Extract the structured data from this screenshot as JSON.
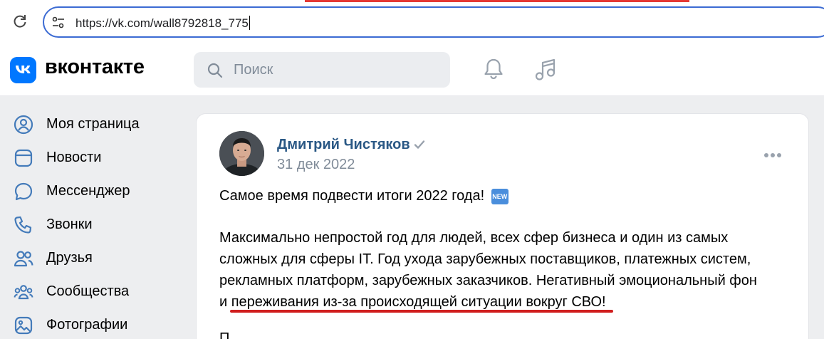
{
  "browser": {
    "url": "https://vk.com/wall8792818_775"
  },
  "header": {
    "brand": "вконтакте",
    "search_placeholder": "Поиск"
  },
  "sidebar": {
    "items": [
      {
        "label": "Моя страница",
        "icon": "user-circle-icon"
      },
      {
        "label": "Новости",
        "icon": "news-icon"
      },
      {
        "label": "Мессенджер",
        "icon": "message-icon"
      },
      {
        "label": "Звонки",
        "icon": "phone-icon"
      },
      {
        "label": "Друзья",
        "icon": "friends-icon"
      },
      {
        "label": "Сообщества",
        "icon": "communities-icon"
      },
      {
        "label": "Фотографии",
        "icon": "photo-icon"
      }
    ]
  },
  "post": {
    "author": "Дмитрий Чистяков",
    "date": "31 дек 2022",
    "headline": "Самое время подвести итоги 2022 года!",
    "badge": "NEW",
    "body_lines": [
      "Максимально непростой год для людей, всех сфер бизнеса и один из самых",
      "сложных для сферы IT. Год ухода зарубежных поставщиков, платежных систем,",
      "рекламных платформ, зарубежных заказчиков. Негативный эмоциональный фон",
      "и переживания из-за происходящей ситуации вокруг СВО!"
    ],
    "next_line_start": "П"
  },
  "colors": {
    "accent": "#0077ff",
    "author_link": "#2a5885",
    "highlight_underline": "#d01e1e"
  }
}
